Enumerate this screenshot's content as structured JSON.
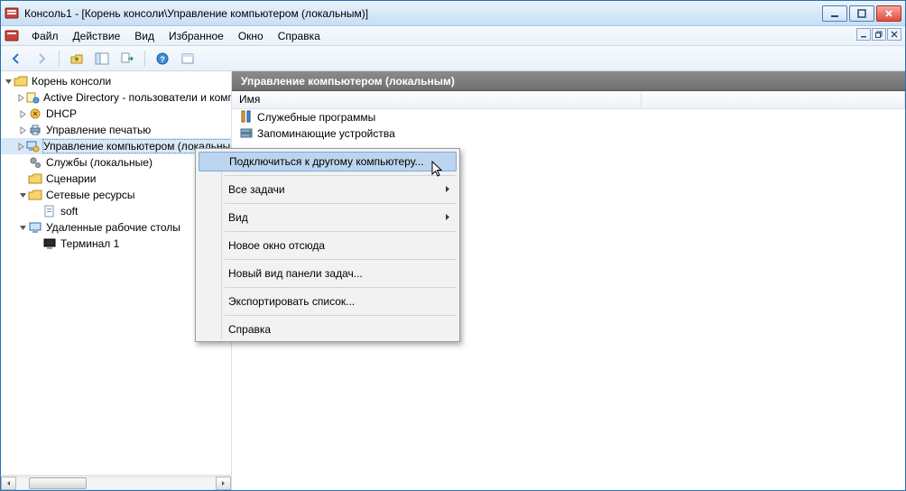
{
  "title": "Консоль1 - [Корень консоли\\Управление компьютером (локальным)]",
  "menubar": {
    "items": [
      "Файл",
      "Действие",
      "Вид",
      "Избранное",
      "Окно",
      "Справка"
    ]
  },
  "tree": {
    "root": "Корень консоли",
    "items": [
      {
        "label": "Active Directory - пользователи и компьютеры",
        "icon": "ad"
      },
      {
        "label": "DHCP",
        "icon": "dhcp"
      },
      {
        "label": "Управление печатью",
        "icon": "printer"
      },
      {
        "label": "Управление компьютером (локальным)",
        "icon": "computer",
        "selected": true
      },
      {
        "label": "Службы (локальные)",
        "icon": "gears"
      },
      {
        "label": "Сценарии",
        "icon": "folder"
      },
      {
        "label": "Сетевые ресурсы",
        "icon": "folder",
        "expanded": true,
        "children": [
          {
            "label": "soft",
            "icon": "doc"
          }
        ]
      },
      {
        "label": "Удаленные рабочие столы",
        "icon": "rdp",
        "expanded": true,
        "children": [
          {
            "label": "Терминал 1",
            "icon": "terminal"
          }
        ]
      }
    ]
  },
  "detail": {
    "header": "Управление компьютером (локальным)",
    "column": "Имя",
    "rows": [
      {
        "label": "Служебные программы",
        "icon": "tools"
      },
      {
        "label": "Запоминающие устройства",
        "icon": "storage"
      }
    ]
  },
  "context_menu": {
    "items": [
      {
        "label": "Подключиться к другому компьютеру...",
        "highlight": true
      },
      {
        "sep": true
      },
      {
        "label": "Все задачи",
        "submenu": true
      },
      {
        "sep": true
      },
      {
        "label": "Вид",
        "submenu": true
      },
      {
        "sep": true
      },
      {
        "label": "Новое окно отсюда"
      },
      {
        "sep": true
      },
      {
        "label": "Новый вид панели задач..."
      },
      {
        "sep": true
      },
      {
        "label": "Экспортировать список..."
      },
      {
        "sep": true
      },
      {
        "label": "Справка"
      }
    ]
  }
}
